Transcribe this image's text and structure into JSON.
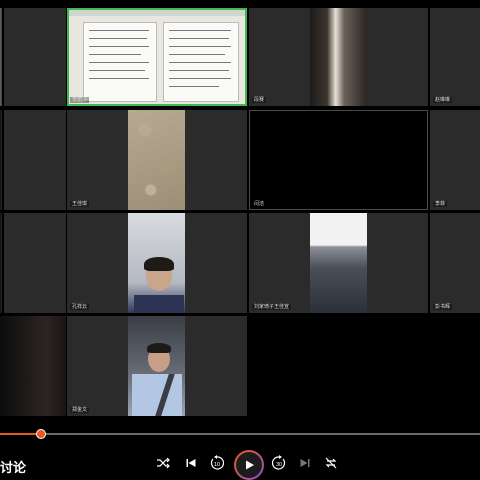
{
  "participants": [
    {
      "label": ""
    },
    {
      "label": "李丽莎"
    },
    {
      "label": "段赛"
    },
    {
      "label": "赵琳琳"
    },
    {
      "label": ""
    },
    {
      "label": "王佳琪"
    },
    {
      "label": "闫洁"
    },
    {
      "label": "李菲"
    },
    {
      "label": ""
    },
    {
      "label": "孔祥云"
    },
    {
      "label": "刘家琦子王佳宣"
    },
    {
      "label": "彭书辉"
    },
    {
      "label": ""
    },
    {
      "label": "郑金文"
    }
  ],
  "player": {
    "caption": "讨论",
    "progress_fraction": 0.085,
    "rewind_seconds": "10",
    "forward_seconds": "30"
  },
  "colors": {
    "accent": "#e8591e",
    "active_border": "#3fb950"
  }
}
